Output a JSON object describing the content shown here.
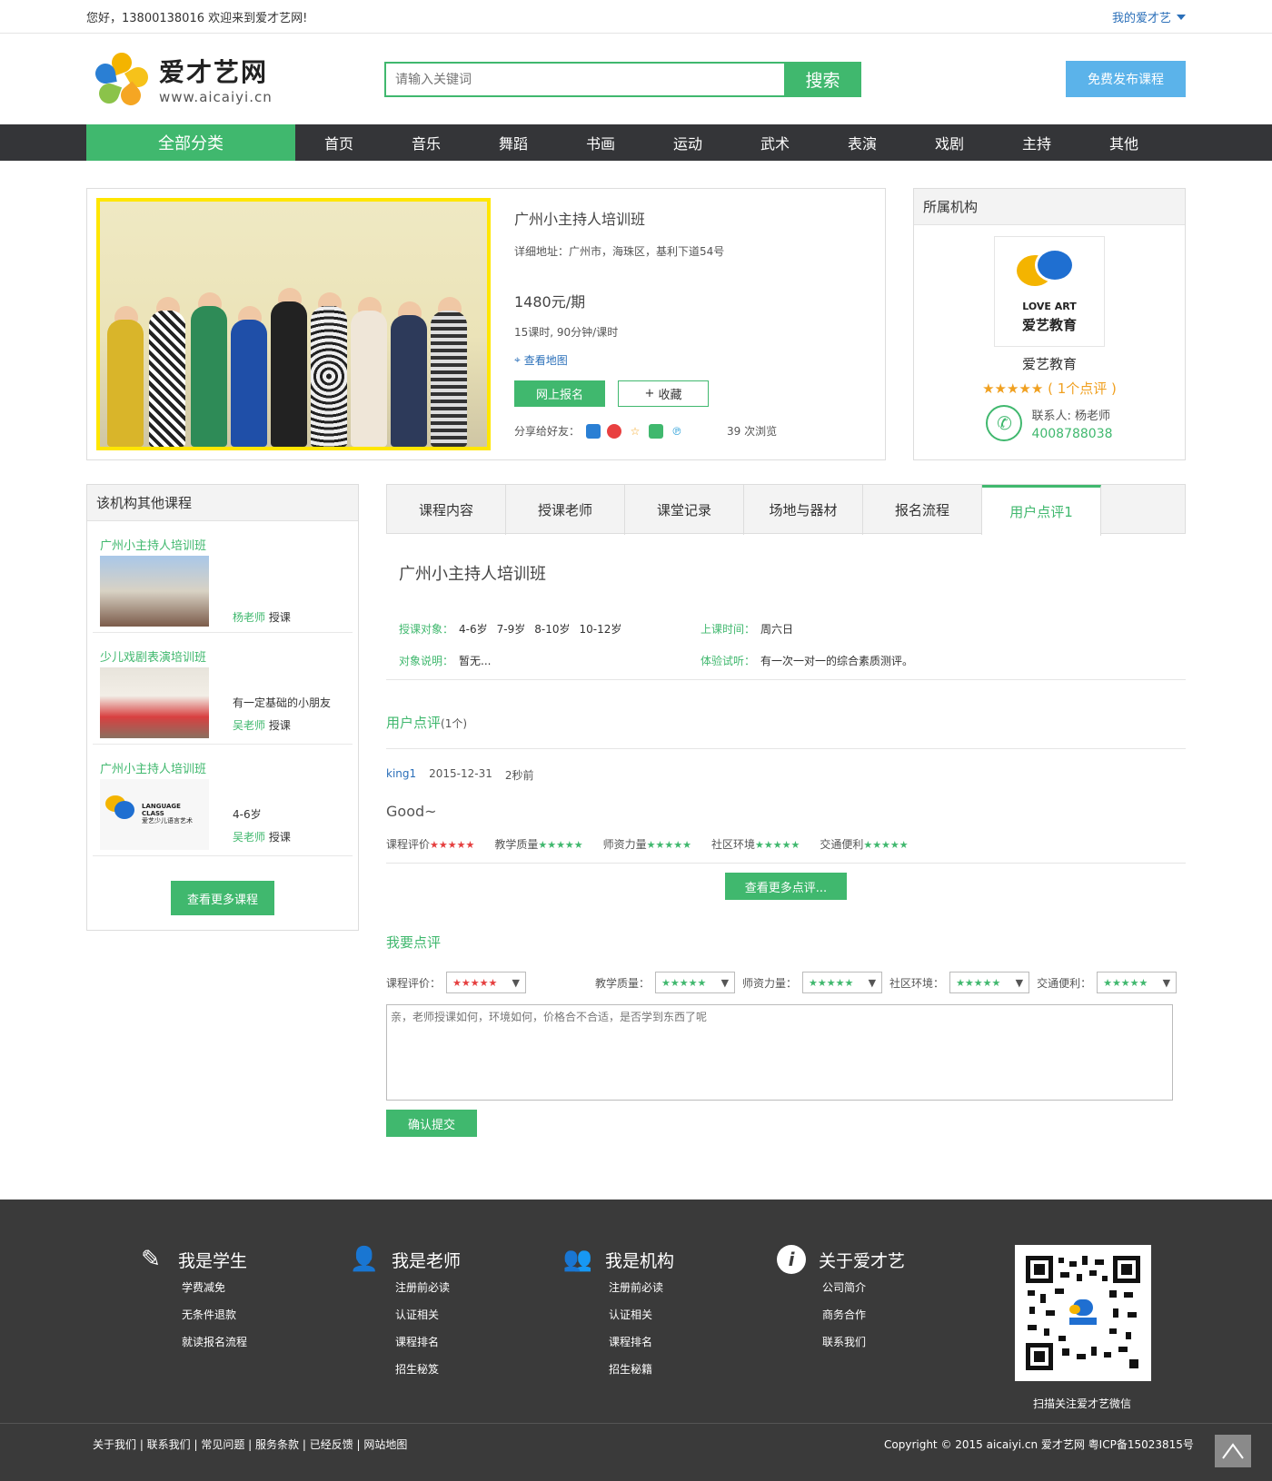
{
  "topbar": {
    "greeting": "您好，13800138016 欢迎来到爱才艺网!",
    "my_account": "我的爱才艺"
  },
  "header": {
    "logo_title": "爱才艺网",
    "logo_url": "www.aicaiyi.cn",
    "search_placeholder": "请输入关键词",
    "search_button": "搜索",
    "publish_button": "免费发布课程"
  },
  "nav": {
    "all_categories": "全部分类",
    "items": [
      "首页",
      "音乐",
      "舞蹈",
      "书画",
      "运动",
      "武术",
      "表演",
      "戏剧",
      "主持",
      "其他"
    ]
  },
  "course": {
    "title": "广州小主持人培训班",
    "address": "详细地址：广州市，海珠区，基利下道54号",
    "price": "1480元/期",
    "sessions": "15课时, 90分钟/课时",
    "map_link": "查看地图",
    "enroll_button": "网上报名",
    "favorite_button": "收藏",
    "share_label": "分享给好友：",
    "views": "39 次浏览"
  },
  "org": {
    "heading": "所属机构",
    "logo_text_top": "LOVE ART",
    "logo_text_bottom": "爱艺教育",
    "name": "爱艺教育",
    "stars": "★★★★★",
    "review_count": "( 1个点评 )",
    "contact": "联系人: 杨老师",
    "phone": "4008788038"
  },
  "side": {
    "heading": "该机构其他课程",
    "items": [
      {
        "name": "广州小主持人培训班",
        "desc": "",
        "teacher": "杨老师",
        "teach_suffix": " 授课"
      },
      {
        "name": "少儿戏剧表演培训班",
        "desc": "有一定基础的小朋友",
        "teacher": "吴老师",
        "teach_suffix": " 授课"
      },
      {
        "name": "广州小主持人培训班",
        "desc": "4-6岁",
        "teacher": "吴老师",
        "teach_suffix": " 授课",
        "logo_line1": "LANGUAGE",
        "logo_line2": "CLASS",
        "logo_line3": "爱艺少儿语言艺术"
      }
    ],
    "more_button": "查看更多课程"
  },
  "tabs": [
    "课程内容",
    "授课老师",
    "课堂记录",
    "场地与器材",
    "报名流程",
    "用户点评1"
  ],
  "detail": {
    "title": "广州小主持人培训班",
    "target_label": "授课对象：",
    "targets": [
      "4-6岁",
      "7-9岁",
      "8-10岁",
      "10-12岁"
    ],
    "time_label": "上课时间：",
    "time": "周六日",
    "note_label": "对象说明：",
    "note": "暂无...",
    "trial_label": "体验试听：",
    "trial": "有一次一对一的综合素质测评。"
  },
  "reviews": {
    "heading": "用户点评",
    "count": "(1个)",
    "user": "king1",
    "date": "2015-12-31",
    "ago": "2秒前",
    "text": "Good~",
    "scores": [
      {
        "label": "课程评价",
        "stars": "★★★★★",
        "color": "#e53e3e"
      },
      {
        "label": "教学质量",
        "stars": "★★★★★",
        "color": "#40b86e"
      },
      {
        "label": "师资力量",
        "stars": "★★★★★",
        "color": "#40b86e"
      },
      {
        "label": "社区环境",
        "stars": "★★★★★",
        "color": "#40b86e"
      },
      {
        "label": "交通便利",
        "stars": "★★★★★",
        "color": "#40b86e"
      }
    ],
    "more_button": "查看更多点评..."
  },
  "my_review": {
    "heading": "我要点评",
    "fields": [
      {
        "label": "课程评价：",
        "value": "★★★★★"
      },
      {
        "label": "教学质量：",
        "value": "★★★★★"
      },
      {
        "label": "师资力量：",
        "value": "★★★★★"
      },
      {
        "label": "社区环境：",
        "value": "★★★★★"
      },
      {
        "label": "交通便利：",
        "value": "★★★★★"
      }
    ],
    "placeholder": "亲，老师授课如何，环境如何，价格合不合适，是否学到东西了呢",
    "submit": "确认提交"
  },
  "footer": {
    "cols": [
      {
        "title": "我是学生",
        "icon": "edit-icon",
        "links": [
          "学费减免",
          "无条件退款",
          "就读报名流程"
        ]
      },
      {
        "title": "我是老师",
        "icon": "user-icon",
        "links": [
          "注册前必读",
          "认证相关",
          "课程排名",
          "招生秘笈"
        ]
      },
      {
        "title": "我是机构",
        "icon": "group-icon",
        "links": [
          "注册前必读",
          "认证相关",
          "课程排名",
          "招生秘籍"
        ]
      },
      {
        "title": "关于爱才艺",
        "icon": "info-icon",
        "links": [
          "公司简介",
          "商务合作",
          "联系我们"
        ]
      }
    ],
    "qr_caption": "扫描关注爱才艺微信",
    "bottom_links": "关于我们 | 联系我们 | 常见问题 | 服务条款 | 已经反馈 | 网站地图",
    "copyright": "Copyright © 2015 aicaiyi.cn 爱才艺网 粤ICP备15023815号"
  },
  "colors": {
    "brand_green": "#40b86e",
    "publish_blue": "#5bb3ea",
    "nav_dark": "#343538",
    "footer_dark": "#3a3a3a",
    "link_blue": "#2a6fb9"
  }
}
